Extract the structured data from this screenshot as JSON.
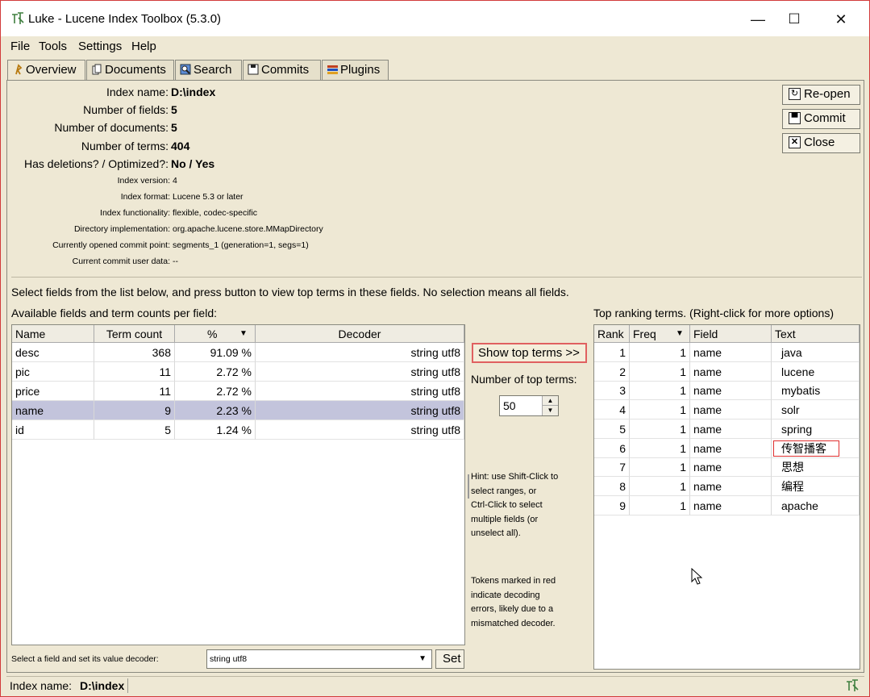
{
  "window": {
    "title": "Luke - Lucene Index Toolbox (5.3.0)",
    "minimize": "—",
    "maximize": "☐",
    "close": "✕"
  },
  "menu": [
    "File",
    "Tools",
    "Settings",
    "Help"
  ],
  "tabs": [
    {
      "label": "Overview",
      "icon": "overview-icon"
    },
    {
      "label": "Documents",
      "icon": "documents-icon"
    },
    {
      "label": "Search",
      "icon": "search-icon"
    },
    {
      "label": "Commits",
      "icon": "commits-icon"
    },
    {
      "label": "Plugins",
      "icon": "plugins-icon"
    }
  ],
  "info": {
    "index_name_label": "Index name:",
    "index_name": "D:\\index",
    "num_fields_label": "Number of fields:",
    "num_fields": "5",
    "num_docs_label": "Number of documents:",
    "num_docs": "5",
    "num_terms_label": "Number of terms:",
    "num_terms": "404",
    "deletions_label": "Has deletions? / Optimized?:",
    "deletions": "No / Yes",
    "index_version_label": "Index version:",
    "index_version": "4",
    "index_format_label": "Index format:",
    "index_format": "Lucene 5.3 or later",
    "functionality_label": "Index functionality:",
    "functionality": "flexible, codec-specific",
    "directory_label": "Directory implementation:",
    "directory": "org.apache.lucene.store.MMapDirectory",
    "commit_point_label": "Currently opened commit point:",
    "commit_point": "segments_1 (generation=1, segs=1)",
    "commit_user_data_label": "Current commit user data:",
    "commit_user_data": "--"
  },
  "buttons": {
    "reopen": "Re-open",
    "commit": "Commit",
    "close": "Close",
    "show_top_terms": "Show top terms >>",
    "set": "Set"
  },
  "select_instruction": "Select fields from the list below, and press button to view top terms in these fields. No selection means all fields.",
  "fields_panel": {
    "title": "Available fields and term counts per field:",
    "columns": [
      "Name",
      "Term count",
      "%",
      "Decoder"
    ],
    "rows": [
      {
        "name": "desc",
        "count": "368",
        "pct": "91.09 %",
        "decoder": "string utf8"
      },
      {
        "name": "pic",
        "count": "11",
        "pct": "2.72 %",
        "decoder": "string utf8"
      },
      {
        "name": "price",
        "count": "11",
        "pct": "2.72 %",
        "decoder": "string utf8"
      },
      {
        "name": "name",
        "count": "9",
        "pct": "2.23 %",
        "decoder": "string utf8"
      },
      {
        "name": "id",
        "count": "5",
        "pct": "1.24 %",
        "decoder": "string utf8"
      }
    ],
    "selected_row": 3,
    "decoder_label": "Select a field and set its value decoder:",
    "decoder_value": "string utf8"
  },
  "middle": {
    "num_top_terms_label": "Number of top terms:",
    "num_top_terms": "50",
    "hint": "Hint: use Shift-Click to select ranges, or Ctrl-Click to select multiple fields (or unselect all).",
    "hint_lines": [
      "Hint: use Shift-Click to",
      "select ranges, or",
      "Ctrl-Click to select",
      "multiple fields (or",
      "unselect all)."
    ],
    "tokens_lines": [
      "Tokens marked in red",
      "indicate decoding",
      "errors, likely due to a",
      "mismatched decoder."
    ]
  },
  "terms_panel": {
    "title": "Top ranking terms. (Right-click for more options)",
    "columns": [
      "Rank",
      "Freq",
      "Field",
      "Text"
    ],
    "rows": [
      {
        "rank": "1",
        "freq": "1",
        "field": "name",
        "text": "java"
      },
      {
        "rank": "2",
        "freq": "1",
        "field": "name",
        "text": "lucene"
      },
      {
        "rank": "3",
        "freq": "1",
        "field": "name",
        "text": "mybatis"
      },
      {
        "rank": "4",
        "freq": "1",
        "field": "name",
        "text": "solr"
      },
      {
        "rank": "5",
        "freq": "1",
        "field": "name",
        "text": "spring"
      },
      {
        "rank": "6",
        "freq": "1",
        "field": "name",
        "text": "传智播客"
      },
      {
        "rank": "7",
        "freq": "1",
        "field": "name",
        "text": "思想"
      },
      {
        "rank": "8",
        "freq": "1",
        "field": "name",
        "text": "编程"
      },
      {
        "rank": "9",
        "freq": "1",
        "field": "name",
        "text": "apache"
      }
    ],
    "highlighted_row": 5
  },
  "status": {
    "label": "Index name:",
    "value": "D:\\index"
  },
  "colors": {
    "background": "#eee8d4",
    "selection": "#c3c4dc",
    "highlight_border": "#e03030"
  }
}
